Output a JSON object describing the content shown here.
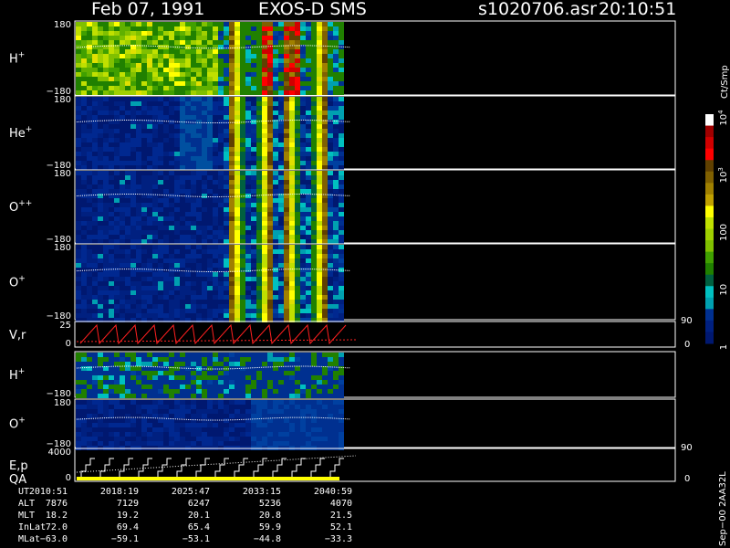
{
  "header": {
    "date": "Feb 07, 1991",
    "instrument": "EXOS-D SMS",
    "file": "s1020706.asr",
    "time": "20:10:51"
  },
  "colorbar": {
    "unit": "Ct/Smp",
    "ticks": [
      {
        "base": "10",
        "exp": "4",
        "frac": 0.0
      },
      {
        "base": "10",
        "exp": "3",
        "frac": 0.25
      },
      {
        "base": "100",
        "exp": "",
        "frac": 0.5
      },
      {
        "base": "10",
        "exp": "",
        "frac": 0.75
      },
      {
        "base": "1",
        "exp": "",
        "frac": 1.0
      }
    ],
    "colors": [
      "#ffffff",
      "#a00000",
      "#d00000",
      "#ff0000",
      "#604000",
      "#806000",
      "#a08000",
      "#c0a000",
      "#ffff00",
      "#c0e000",
      "#a0d000",
      "#80c000",
      "#40a000",
      "#208000",
      "#006040",
      "#00c0c0",
      "#00a0b0",
      "#003090",
      "#002080",
      "#001870"
    ]
  },
  "panels": [
    {
      "label": "H",
      "sup": "+",
      "ymax": "180",
      "ymin": "−180",
      "kind": "pitch",
      "intensity": "high"
    },
    {
      "label": "He",
      "sup": "+",
      "ymax": "180",
      "ymin": "−180",
      "kind": "pitch",
      "intensity": "mid"
    },
    {
      "label": "O",
      "sup": "++",
      "ymax": "180",
      "ymin": "−180",
      "kind": "pitch",
      "intensity": "mid"
    },
    {
      "label": "O",
      "sup": "+",
      "ymax": "180",
      "ymin": "−180",
      "kind": "pitch",
      "intensity": "mid"
    },
    {
      "label": "V,r",
      "sup": "",
      "ymax": "25",
      "ymin": "0",
      "kind": "line",
      "right_top": "90",
      "right_bottom": "0"
    },
    {
      "label": "H",
      "sup": "+",
      "ymax": "",
      "ymin": "−180",
      "kind": "pitch",
      "intensity": "low"
    },
    {
      "label": "O",
      "sup": "+",
      "ymax": "180",
      "ymin": "−180",
      "kind": "pitch",
      "intensity": "low"
    },
    {
      "label": "E,p",
      "label2": "QA",
      "sup": "",
      "ymax": "4000",
      "ymin": "0",
      "kind": "steps",
      "right_top": "90",
      "right_bottom": "0"
    }
  ],
  "chart_data": {
    "type": "heatmap",
    "x_labels": [
      "2010:51",
      "2018:19",
      "2025:47",
      "2033:15",
      "2040:59"
    ],
    "rows": [
      {
        "name": "UT",
        "values": [
          "2010:51",
          "2018:19",
          "2025:47",
          "2033:15",
          "2040:59"
        ]
      },
      {
        "name": "ALT",
        "values": [
          "7876",
          "7129",
          "6247",
          "5236",
          "4070"
        ]
      },
      {
        "name": "MLT",
        "values": [
          "18.2",
          "19.2",
          "20.1",
          "20.8",
          "21.5"
        ]
      },
      {
        "name": "InLat",
        "values": [
          "72.0",
          "69.4",
          "65.4",
          "59.9",
          "52.1"
        ]
      },
      {
        "name": "MLat",
        "values": [
          "−63.0",
          "−59.1",
          "−53.1",
          "−44.8",
          "−33.3"
        ]
      }
    ]
  },
  "footer": {
    "side_label": "Sep−00  2AA32L"
  }
}
